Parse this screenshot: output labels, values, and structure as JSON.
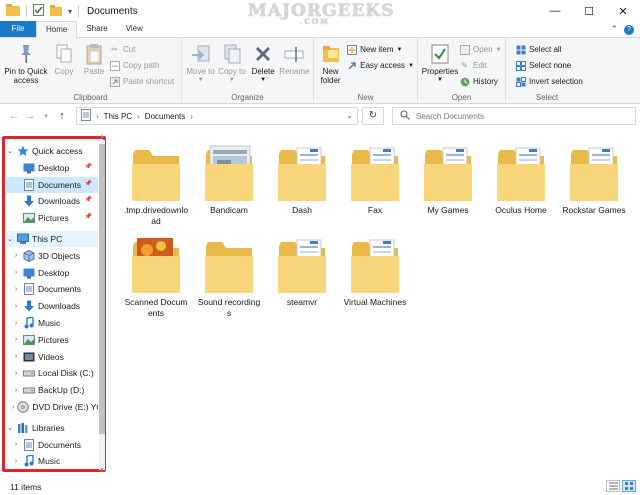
{
  "window": {
    "title": "Documents",
    "watermark": "MAJORGEEKS",
    "watermark_sub": ".COM"
  },
  "tabs": [
    {
      "label": "File"
    },
    {
      "label": "Home"
    },
    {
      "label": "Share"
    },
    {
      "label": "View"
    }
  ],
  "ribbon": {
    "clipboard": {
      "label": "Clipboard",
      "pin_quick_access": "Pin to Quick access",
      "copy": "Copy",
      "paste": "Paste",
      "cut": "Cut",
      "copy_path": "Copy path",
      "paste_shortcut": "Paste shortcut"
    },
    "organize": {
      "label": "Organize",
      "move_to": "Move to",
      "copy_to": "Copy to",
      "delete": "Delete",
      "rename": "Rename"
    },
    "new": {
      "label": "New",
      "new_folder": "New folder",
      "new_item": "New item",
      "easy_access": "Easy access"
    },
    "open": {
      "label": "Open",
      "properties": "Properties",
      "open": "Open",
      "edit": "Edit",
      "history": "History"
    },
    "select": {
      "label": "Select",
      "select_all": "Select all",
      "select_none": "Select none",
      "invert_selection": "Invert selection"
    }
  },
  "address": {
    "crumbs": [
      "This PC",
      "Documents"
    ],
    "search_placeholder": "Search Documents"
  },
  "nav_pane": {
    "items": [
      {
        "label": "Quick access",
        "icon": "star-icon",
        "level": 0,
        "expanded": true
      },
      {
        "label": "Desktop",
        "icon": "desktop-icon",
        "level": 1,
        "pinned": true
      },
      {
        "label": "Documents",
        "icon": "documents-icon",
        "level": 1,
        "pinned": true,
        "selected": true
      },
      {
        "label": "Downloads",
        "icon": "downloads-icon",
        "level": 1,
        "pinned": true
      },
      {
        "label": "Pictures",
        "icon": "pictures-icon",
        "level": 1,
        "pinned": true
      },
      {
        "label": "This PC",
        "icon": "computer-icon",
        "level": 0,
        "expanded": true,
        "hover": true
      },
      {
        "label": "3D Objects",
        "icon": "3d-objects-icon",
        "level": 1
      },
      {
        "label": "Desktop",
        "icon": "desktop-icon",
        "level": 1
      },
      {
        "label": "Documents",
        "icon": "documents-icon",
        "level": 1
      },
      {
        "label": "Downloads",
        "icon": "downloads-icon",
        "level": 1
      },
      {
        "label": "Music",
        "icon": "music-icon",
        "level": 1
      },
      {
        "label": "Pictures",
        "icon": "pictures-icon",
        "level": 1
      },
      {
        "label": "Videos",
        "icon": "videos-icon",
        "level": 1
      },
      {
        "label": "Local Disk (C:)",
        "icon": "drive-icon",
        "level": 1
      },
      {
        "label": "BackUp (D:)",
        "icon": "drive-icon",
        "level": 1
      },
      {
        "label": "DVD Drive (E:) YC",
        "icon": "dvd-icon",
        "level": 1
      },
      {
        "label": "Libraries",
        "icon": "library-icon",
        "level": 0,
        "expanded": true
      },
      {
        "label": "Documents",
        "icon": "documents-icon",
        "level": 1
      },
      {
        "label": "Music",
        "icon": "music-icon",
        "level": 1
      }
    ]
  },
  "files": [
    {
      "name": ".tmp.drivedownload",
      "kind": "folder-empty"
    },
    {
      "name": "Bandicam",
      "kind": "folder-image"
    },
    {
      "name": "Dash",
      "kind": "folder-docs"
    },
    {
      "name": "Fax",
      "kind": "folder-docs"
    },
    {
      "name": "My Games",
      "kind": "folder-docs"
    },
    {
      "name": "Oculus Home",
      "kind": "folder-docs"
    },
    {
      "name": "Rockstar Games",
      "kind": "folder-docs"
    },
    {
      "name": "Scanned Documents",
      "kind": "folder-photo"
    },
    {
      "name": "Sound recordings",
      "kind": "folder-empty"
    },
    {
      "name": "steamvr",
      "kind": "folder-docs"
    },
    {
      "name": "Virtual Machines",
      "kind": "folder-docs"
    }
  ],
  "status": {
    "item_count": "11 items"
  },
  "colors": {
    "accent": "#1979ca",
    "selection": "#cce8ff",
    "highlight_box": "#e1252a",
    "folder": "#f5d37a"
  }
}
